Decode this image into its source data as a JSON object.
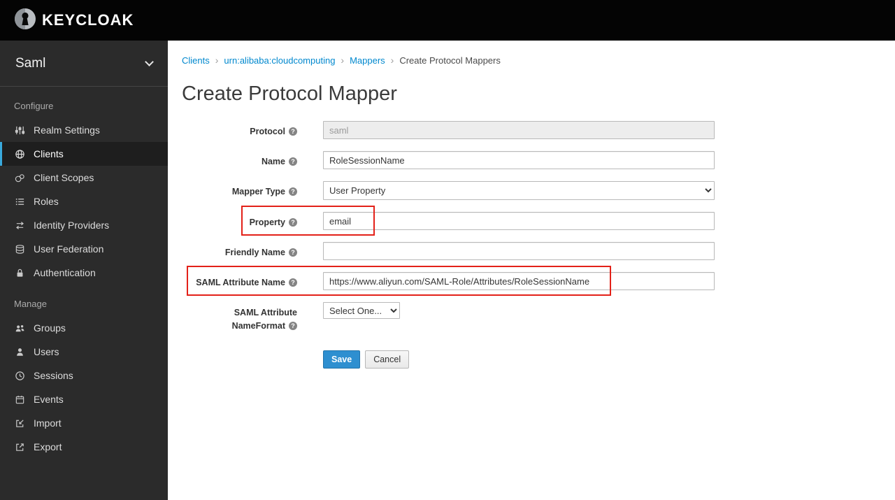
{
  "header": {
    "brand": "KEYCLOAK"
  },
  "sidebar": {
    "realm_selector": {
      "label": "Saml"
    },
    "sections": [
      {
        "heading": "Configure",
        "items": [
          {
            "label": "Realm Settings",
            "icon": "sliders-icon",
            "active": false
          },
          {
            "label": "Clients",
            "icon": "clients-icon",
            "active": true
          },
          {
            "label": "Client Scopes",
            "icon": "client-scopes-icon",
            "active": false
          },
          {
            "label": "Roles",
            "icon": "roles-icon",
            "active": false
          },
          {
            "label": "Identity Providers",
            "icon": "exchange-arrows-icon",
            "active": false
          },
          {
            "label": "User Federation",
            "icon": "database-icon",
            "active": false
          },
          {
            "label": "Authentication",
            "icon": "lock-icon",
            "active": false
          }
        ]
      },
      {
        "heading": "Manage",
        "items": [
          {
            "label": "Groups",
            "icon": "groups-icon",
            "active": false
          },
          {
            "label": "Users",
            "icon": "user-icon",
            "active": false
          },
          {
            "label": "Sessions",
            "icon": "clock-icon",
            "active": false
          },
          {
            "label": "Events",
            "icon": "calendar-icon",
            "active": false
          },
          {
            "label": "Import",
            "icon": "import-icon",
            "active": false
          },
          {
            "label": "Export",
            "icon": "export-icon",
            "active": false
          }
        ]
      }
    ]
  },
  "breadcrumb": {
    "separator": "›",
    "items": [
      "Clients",
      "urn:alibaba:cloudcomputing",
      "Mappers",
      "Create Protocol Mappers"
    ]
  },
  "page": {
    "title": "Create Protocol Mapper"
  },
  "form": {
    "fields": [
      {
        "label": "Protocol",
        "type": "text",
        "value": "saml",
        "disabled": true
      },
      {
        "label": "Name",
        "type": "text",
        "value": "RoleSessionName"
      },
      {
        "label": "Mapper Type",
        "type": "select",
        "value": "User Property"
      },
      {
        "label": "Property",
        "type": "text",
        "value": "email",
        "highlighted": true
      },
      {
        "label": "Friendly Name",
        "type": "text",
        "value": ""
      },
      {
        "label": "SAML Attribute Name",
        "type": "text",
        "value": "https://www.aliyun.com/SAML-Role/Attributes/RoleSessionName",
        "highlighted": true
      },
      {
        "label": "SAML Attribute NameFormat",
        "type": "select",
        "value": "Select One..."
      }
    ],
    "buttons": {
      "save": "Save",
      "cancel": "Cancel"
    }
  },
  "icons": {
    "help": "?"
  },
  "colors": {
    "accent": "#0088ce",
    "annotation": "#e32119",
    "sidebar_bg": "#2b2b2b",
    "sidebar_active_border": "#39a9dc",
    "header_bg": "#040404",
    "primary_button": "#2e8fd0"
  }
}
